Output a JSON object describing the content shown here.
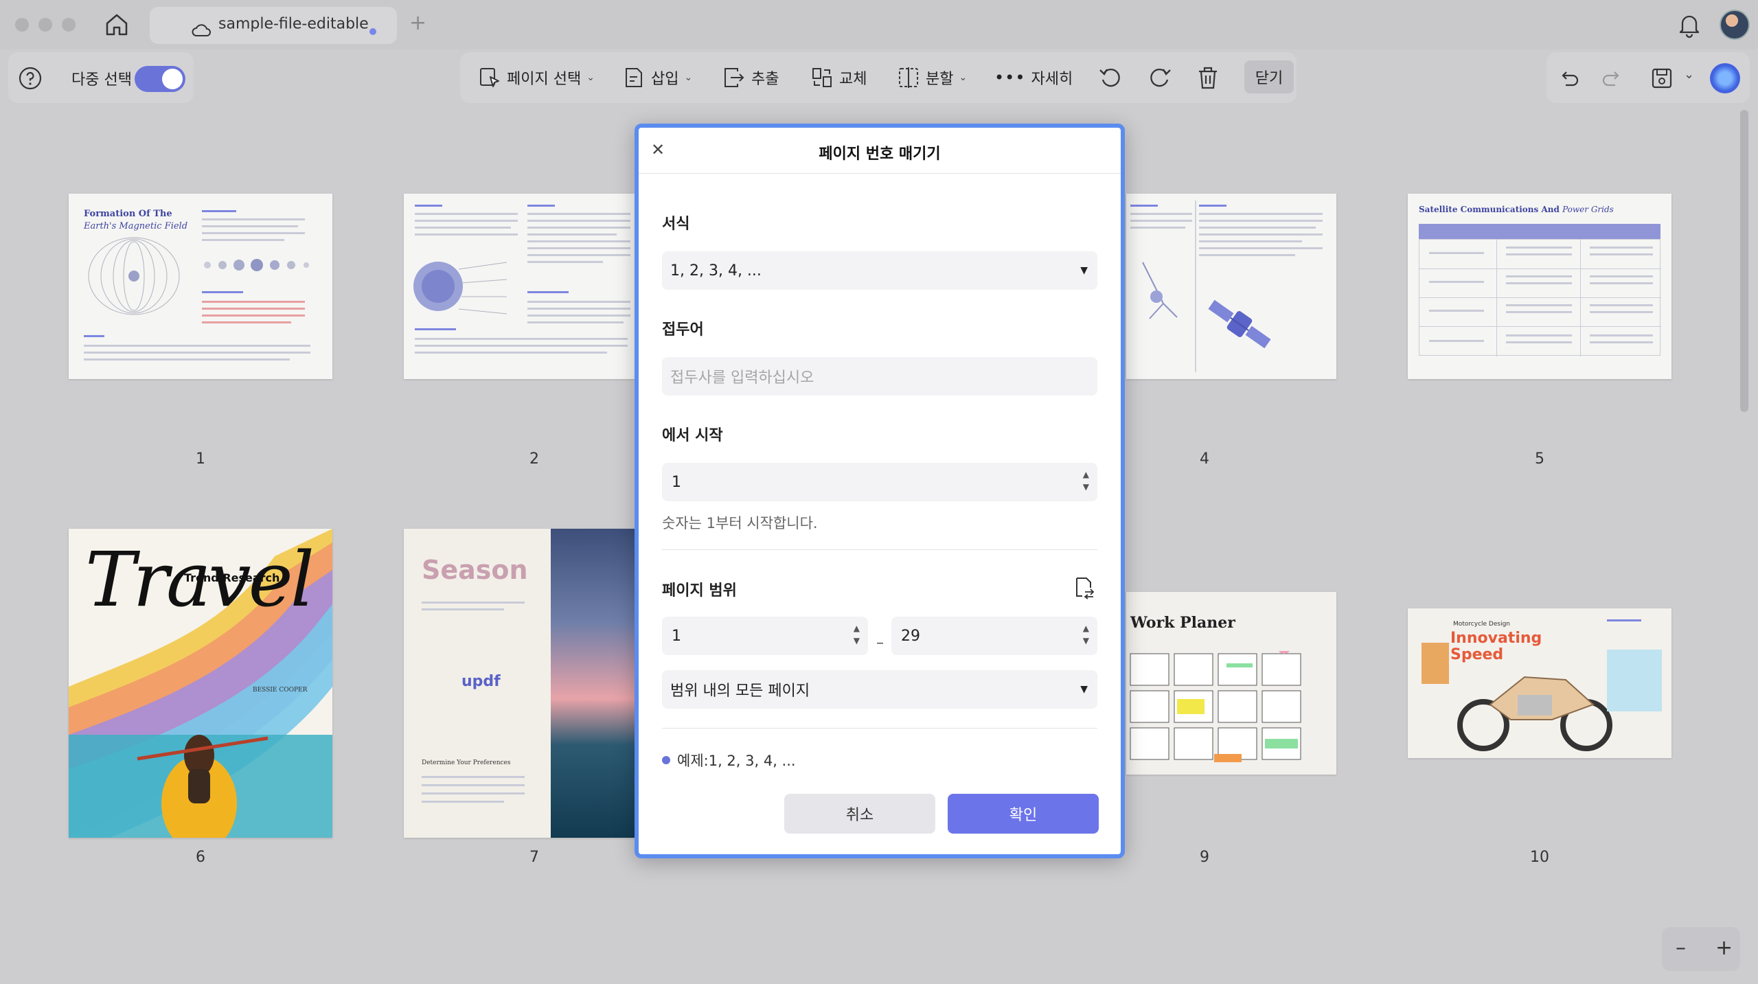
{
  "tab": {
    "title": "sample-file-editable",
    "plus": "+"
  },
  "toolbar": {
    "multi_select_label": "다중 선택",
    "page_select": "페이지 선택",
    "insert": "삽입",
    "extract": "추출",
    "replace": "교체",
    "split": "분할",
    "more": "자세히",
    "close": "닫기"
  },
  "pages": [
    {
      "num": "1",
      "title1": "Formation Of The",
      "title2": "Earth's Magnetic Field"
    },
    {
      "num": "2"
    },
    {
      "num": "4"
    },
    {
      "num": "5",
      "title1": "Satellite Communications And",
      "title2": "Power Grids"
    },
    {
      "num": "6",
      "title1": "Travel",
      "title2": "Trend Research",
      "author": "BESSIE COOPER"
    },
    {
      "num": "7",
      "title1": "Season",
      "title2": "updf",
      "subtitle": "Determine Your Preferences"
    },
    {
      "num": "9",
      "title1": "Work Planer"
    },
    {
      "num": "10",
      "title1": "Innovating",
      "title2": "Speed",
      "subtitle": "Motorcycle Design"
    }
  ],
  "dialog": {
    "title": "페이지 번호 매기기",
    "format_label": "서식",
    "format_value": "1, 2, 3, 4, ...",
    "prefix_label": "접두어",
    "prefix_placeholder": "접두사를 입력하십시오",
    "start_label": "에서 시작",
    "start_value": "1",
    "start_hint": "숫자는 1부터 시작합니다.",
    "range_label": "페이지 범위",
    "range_from": "1",
    "range_dash": "–",
    "range_to": "29",
    "range_mode": "범위 내의 모든 페이지",
    "example": "예제:1, 2, 3, 4, ...",
    "cancel": "취소",
    "ok": "확인"
  },
  "zoom": {
    "minus": "–",
    "plus": "+"
  },
  "colors": {
    "accent": "#6c74ea",
    "dialog_border": "#5b8cf0",
    "background": "#cdcdd0"
  }
}
